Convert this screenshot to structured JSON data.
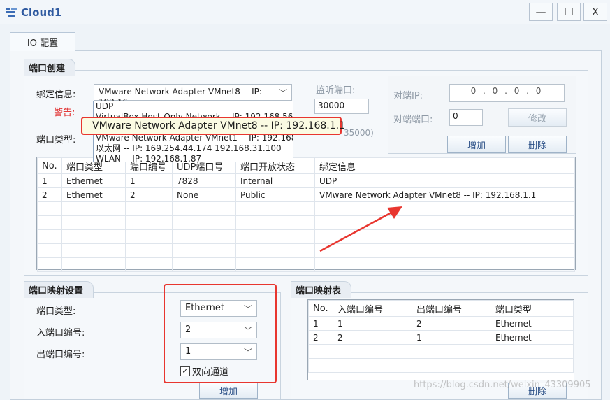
{
  "window": {
    "title": "Cloud1",
    "minimize": "—",
    "maximize": "☐",
    "close": "X"
  },
  "tabs": [
    {
      "label": "IO 配置"
    }
  ],
  "port_create": {
    "group_title": "端口创建",
    "bind_label": "绑定信息:",
    "bind_value": "VMware Network Adapter VMnet8 -- IP: 192.16",
    "warning_label": "警告:",
    "port_type_label": "端口类型:",
    "listen_port_label": "监听端口:",
    "listen_port_value": "30000",
    "listen_hint": "35000)",
    "peer_ip_label": "对端IP:",
    "peer_ip_value": "0 . 0 . 0 . 0",
    "peer_port_label": "对端端口:",
    "peer_port_value": "0",
    "modify_button": "修改",
    "add_button": "增加",
    "delete_button": "删除",
    "dropdown_items": [
      "UDP",
      "VirtualBox Host-Only Network -- IP: 192.168.56.1",
      "VMware Network Adapter VMnet1 -- IP: 192.168.0.",
      "以太网 -- IP: 169.254.44.174 192.168.31.100",
      "WLAN -- IP: 192.168.1.87"
    ],
    "dropdown_highlight": "VMware Network Adapter VMnet8 -- IP: 192.168.1.1",
    "table": {
      "headers": [
        "No.",
        "端口类型",
        "端口编号",
        "UDP端口号",
        "端口开放状态",
        "绑定信息"
      ],
      "rows": [
        [
          "1",
          "Ethernet",
          "1",
          "7828",
          "Internal",
          "UDP"
        ],
        [
          "2",
          "Ethernet",
          "2",
          "None",
          "Public",
          "VMware Network Adapter VMnet8 -- IP: 192.168.1.1"
        ]
      ]
    }
  },
  "port_mapping_settings": {
    "group_title": "端口映射设置",
    "port_type_label": "端口类型:",
    "port_type_value": "Ethernet",
    "in_port_label": "入端口编号:",
    "in_port_value": "2",
    "out_port_label": "出端口编号:",
    "out_port_value": "1",
    "bidirectional_label": "双向通道",
    "add_button": "增加"
  },
  "port_mapping_table": {
    "group_title": "端口映射表",
    "headers": [
      "No.",
      "入端口编号",
      "出端口编号",
      "端口类型"
    ],
    "rows": [
      [
        "1",
        "1",
        "2",
        "Ethernet"
      ],
      [
        "2",
        "2",
        "1",
        "Ethernet"
      ]
    ],
    "delete_button": "删除"
  },
  "watermark": "https://blog.csdn.net/weixin_43309905",
  "colors": {
    "annotation_red": "#e8362f",
    "title_blue": "#2f5aa0"
  }
}
